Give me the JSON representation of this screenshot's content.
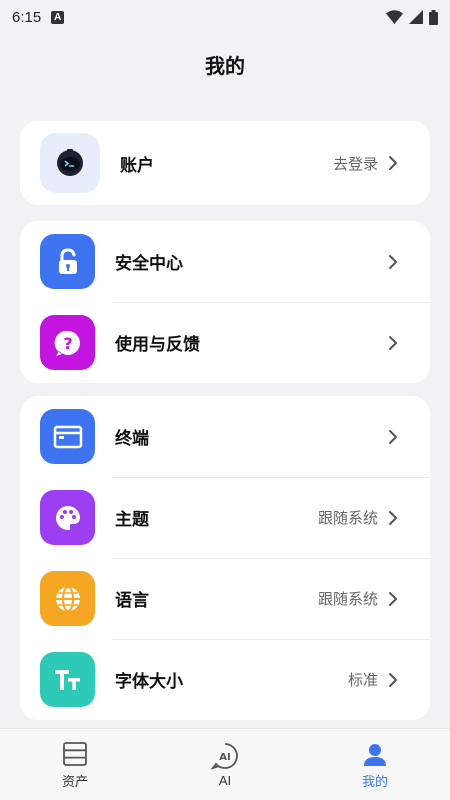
{
  "status_bar": {
    "time": "6:15",
    "notification_letter": "A"
  },
  "header": {
    "title": "我的"
  },
  "account": {
    "label": "账户",
    "action": "去登录"
  },
  "section1": {
    "items": [
      {
        "label": "安全中心",
        "value": "",
        "icon": "lock-icon",
        "color": "#3f74f0"
      },
      {
        "label": "使用与反馈",
        "value": "",
        "icon": "question-icon",
        "color": "#c315e0"
      }
    ]
  },
  "section2": {
    "items": [
      {
        "label": "终端",
        "value": "",
        "icon": "terminal-icon",
        "color": "#3f74f0"
      },
      {
        "label": "主题",
        "value": "跟随系统",
        "icon": "palette-icon",
        "color": "#9b3ff0"
      },
      {
        "label": "语言",
        "value": "跟随系统",
        "icon": "globe-icon",
        "color": "#f5a623"
      },
      {
        "label": "字体大小",
        "value": "标准",
        "icon": "font-size-icon",
        "color": "#2ec9b7"
      }
    ]
  },
  "bottom_nav": {
    "items": [
      {
        "label": "资产",
        "icon": "assets-icon"
      },
      {
        "label": "AI",
        "icon": "ai-icon"
      },
      {
        "label": "我的",
        "icon": "profile-icon"
      }
    ]
  }
}
